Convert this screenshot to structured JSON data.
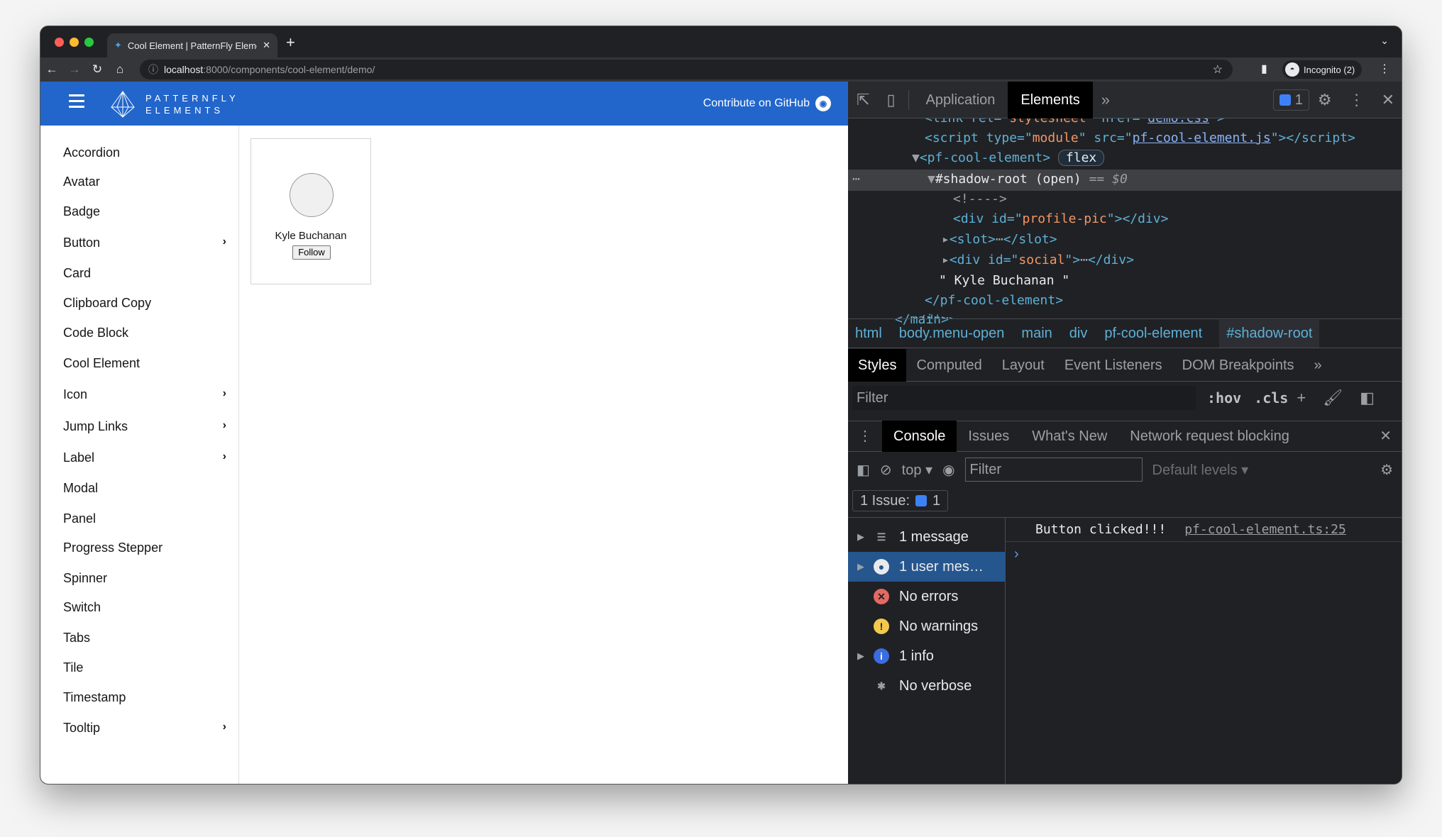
{
  "browser": {
    "tab_title": "Cool Element | PatternFly Elements",
    "url_host": "localhost",
    "url_path": ":8000/components/cool-element/demo/",
    "profile": "Incognito (2)"
  },
  "site": {
    "logo_top": "PATTERNFLY",
    "logo_bottom": "ELEMENTS",
    "contribute": "Contribute on GitHub",
    "accent": "#2266cc"
  },
  "sidebar": {
    "items": [
      {
        "label": "Accordion",
        "expand": false
      },
      {
        "label": "Avatar",
        "expand": false
      },
      {
        "label": "Badge",
        "expand": false
      },
      {
        "label": "Button",
        "expand": true
      },
      {
        "label": "Card",
        "expand": false
      },
      {
        "label": "Clipboard Copy",
        "expand": false
      },
      {
        "label": "Code Block",
        "expand": false
      },
      {
        "label": "Cool Element",
        "expand": false
      },
      {
        "label": "Icon",
        "expand": true
      },
      {
        "label": "Jump Links",
        "expand": true
      },
      {
        "label": "Label",
        "expand": true
      },
      {
        "label": "Modal",
        "expand": false
      },
      {
        "label": "Panel",
        "expand": false
      },
      {
        "label": "Progress Stepper",
        "expand": false
      },
      {
        "label": "Spinner",
        "expand": false
      },
      {
        "label": "Switch",
        "expand": false
      },
      {
        "label": "Tabs",
        "expand": false
      },
      {
        "label": "Tile",
        "expand": false
      },
      {
        "label": "Timestamp",
        "expand": false
      },
      {
        "label": "Tooltip",
        "expand": true
      }
    ]
  },
  "card": {
    "name": "Kyle Buchanan",
    "button": "Follow"
  },
  "devtools": {
    "tabs": [
      "Application",
      "Elements"
    ],
    "active_tab": "Elements",
    "issues_count": "1",
    "dom": {
      "l0a": "<link rel=\"",
      "l0b": "stylesheet",
      "l0c": "\" href=\"",
      "l0d": "demo.css",
      "l0e": "\">",
      "l1a": "<script type=\"",
      "l1b": "module",
      "l1c": "\" src=\"",
      "l1d": "pf-cool-element.js",
      "l1e": "\"></script>",
      "l2": "<pf-cool-element>",
      "l2pill": "flex",
      "l3": "#shadow-root (open)",
      "l3b": "== $0",
      "l4": "<!---->",
      "l5a": "<div id=\"",
      "l5b": "profile-pic",
      "l5c": "\"></div>",
      "l6a": "<slot>",
      "l6b": "</slot>",
      "l7a": "<div id=\"",
      "l7b": "social",
      "l7c": "\">",
      "l7d": "</div>",
      "l8": "\" Kyle Buchanan \"",
      "l9": "</pf-cool-element>",
      "l10": "</div>",
      "l11": "</main>"
    },
    "breadcrumbs": [
      "html",
      "body.menu-open",
      "main",
      "div",
      "pf-cool-element",
      "#shadow-root"
    ],
    "styles_tabs": [
      "Styles",
      "Computed",
      "Layout",
      "Event Listeners",
      "DOM Breakpoints"
    ],
    "filter_placeholder": "Filter",
    "hov": ":hov",
    "cls": ".cls",
    "drawer_tabs": [
      "Console",
      "Issues",
      "What's New",
      "Network request blocking"
    ],
    "console": {
      "context": "top",
      "filter_placeholder": "Filter",
      "levels": "Default levels",
      "issue_label": "1 Issue:",
      "issue_count": "1",
      "sidebar": [
        "1 message",
        "1 user mes…",
        "No errors",
        "No warnings",
        "1 info",
        "No verbose"
      ],
      "log_message": "Button clicked!!!",
      "log_source": "pf-cool-element.ts:25"
    }
  }
}
